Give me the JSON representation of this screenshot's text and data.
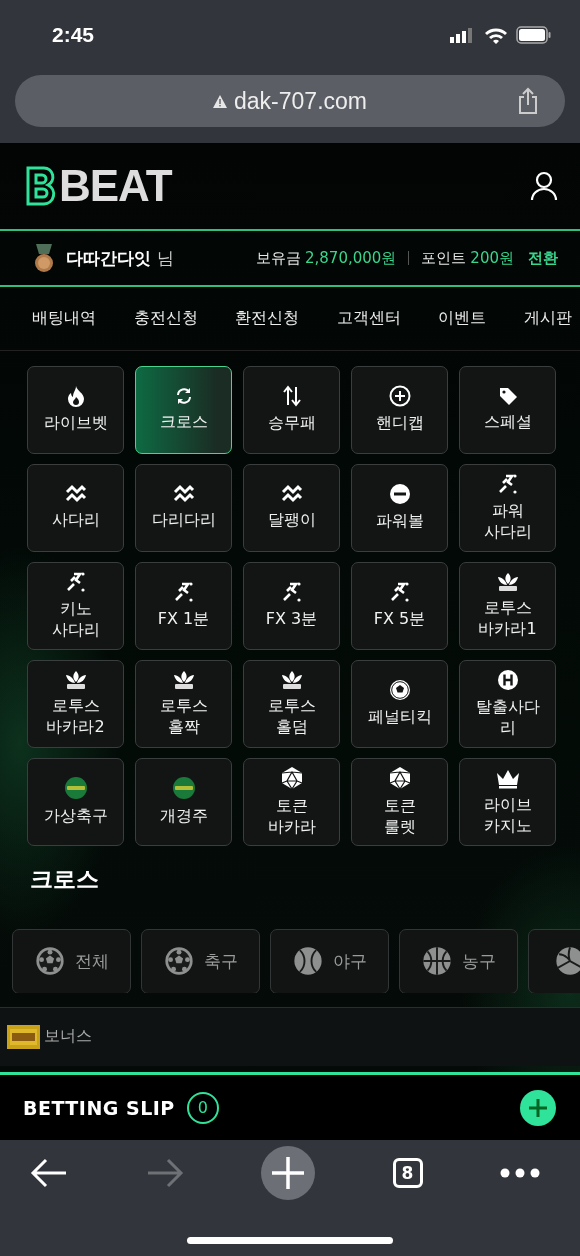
{
  "status_bar": {
    "time": "2:45"
  },
  "browser": {
    "url": "dak-707.com",
    "tab_count": "8",
    "forward_disabled": true
  },
  "header": {
    "logo": "BEAT"
  },
  "user_bar": {
    "name": "다따간다잇",
    "suffix": "님",
    "balance_label": "보유금",
    "balance": "2,870,000원",
    "point_label": "포인트",
    "points": "200원",
    "convert": "전환"
  },
  "nav": [
    "배팅내역",
    "충전신청",
    "환전신청",
    "고객센터",
    "이벤트",
    "게시판"
  ],
  "games": [
    {
      "label": "라이브벳",
      "kind": "fire",
      "selected": false
    },
    {
      "label": "크로스",
      "kind": "sync",
      "selected": true
    },
    {
      "label": "승무패",
      "kind": "updown",
      "selected": false
    },
    {
      "label": "핸디캡",
      "kind": "plus",
      "selected": false
    },
    {
      "label": "스페셜",
      "kind": "tag",
      "selected": false
    },
    {
      "label": "사다리",
      "kind": "zigzag",
      "selected": false
    },
    {
      "label": "다리다리",
      "kind": "zigzag",
      "selected": false
    },
    {
      "label": "달팽이",
      "kind": "zigzag",
      "selected": false
    },
    {
      "label": "파워볼",
      "kind": "ball",
      "selected": false
    },
    {
      "label": "파워\n사다리",
      "kind": "runner",
      "selected": false
    },
    {
      "label": "키노\n사다리",
      "kind": "runner",
      "selected": false
    },
    {
      "label": "FX 1분",
      "kind": "runner",
      "selected": false
    },
    {
      "label": "FX 3분",
      "kind": "runner",
      "selected": false
    },
    {
      "label": "FX 5분",
      "kind": "runner",
      "selected": false
    },
    {
      "label": "로투스\n바카라1",
      "kind": "lotus",
      "selected": false
    },
    {
      "label": "로투스\n바카라2",
      "kind": "lotus",
      "selected": false
    },
    {
      "label": "로투스\n홀짝",
      "kind": "lotus",
      "selected": false
    },
    {
      "label": "로투스\n홀덤",
      "kind": "lotus",
      "selected": false
    },
    {
      "label": "페널티킥",
      "kind": "soccer",
      "selected": false
    },
    {
      "label": "탈출사다\n리",
      "kind": "hcircle",
      "selected": false
    },
    {
      "label": "가상축구",
      "kind": "badge",
      "selected": false
    },
    {
      "label": "개경주",
      "kind": "badge",
      "selected": false
    },
    {
      "label": "토큰\n바카라",
      "kind": "dice",
      "selected": false
    },
    {
      "label": "토큰\n룰렛",
      "kind": "dice",
      "selected": false
    },
    {
      "label": "라이브\n카지노",
      "kind": "crown",
      "selected": false
    }
  ],
  "section_title": "크로스",
  "sports": [
    {
      "label": "전체",
      "kind": "soccer"
    },
    {
      "label": "축구",
      "kind": "soccer"
    },
    {
      "label": "야구",
      "kind": "baseball"
    },
    {
      "label": "농구",
      "kind": "basketball"
    },
    {
      "kind": "volleyball"
    }
  ],
  "bonus_row": {
    "label": "보너스"
  },
  "betting_slip": {
    "title": "BETTING SLIP",
    "count": "0"
  }
}
